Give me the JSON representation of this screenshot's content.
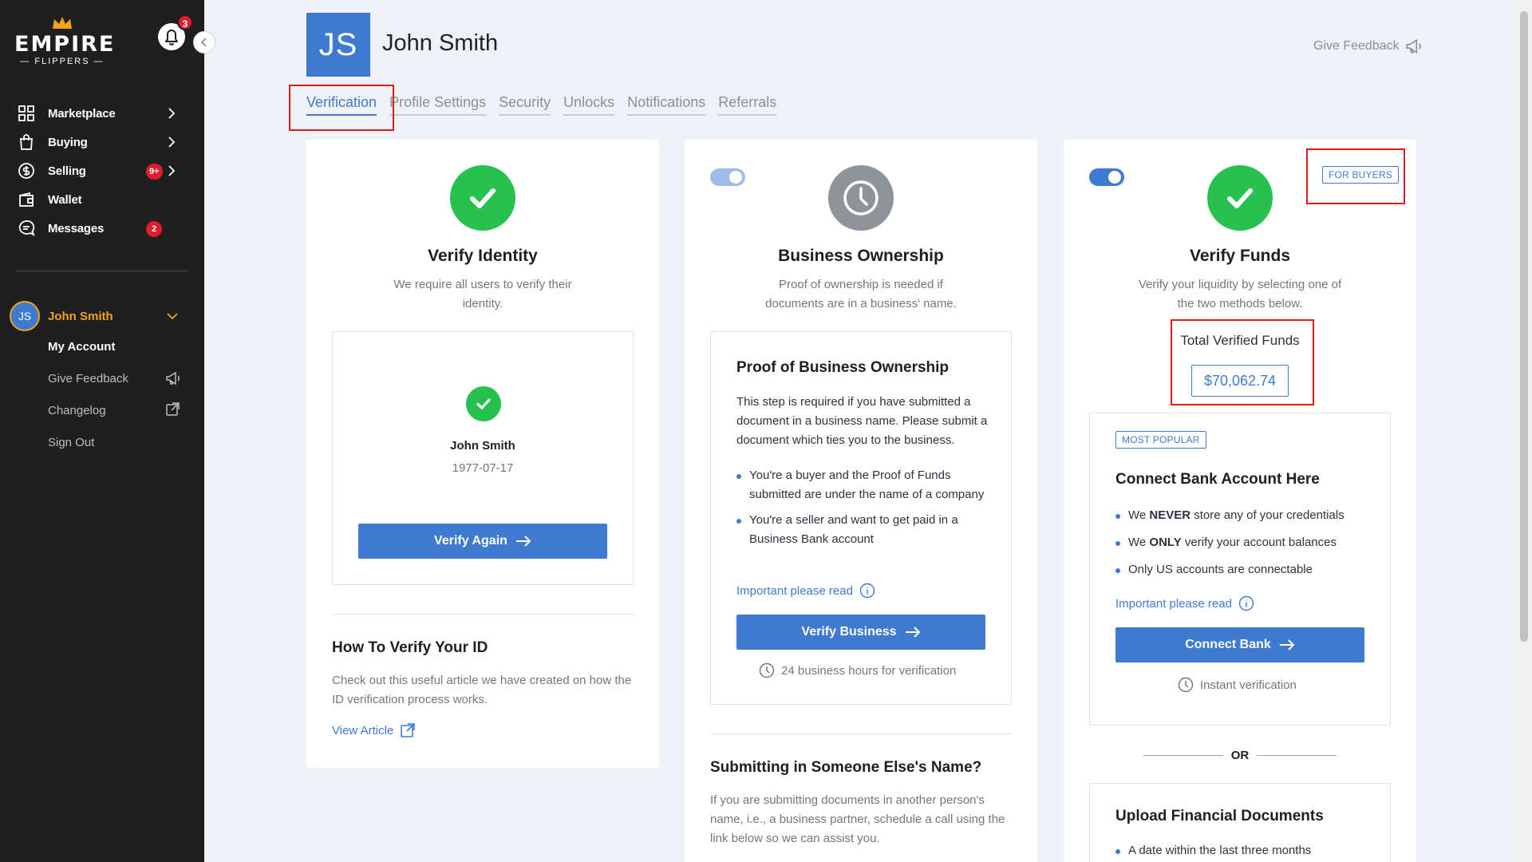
{
  "sidebar": {
    "logo": {
      "word": "EMPIRE",
      "sub": "— FLIPPERS —"
    },
    "notifications_count": "3",
    "nav": [
      {
        "label": "Marketplace",
        "icon": "grid-icon",
        "has_chevron": true
      },
      {
        "label": "Buying",
        "icon": "shopping-bag-icon",
        "has_chevron": true
      },
      {
        "label": "Selling",
        "icon": "dollar-circle-icon",
        "badge": "9+",
        "has_chevron": true
      },
      {
        "label": "Wallet",
        "icon": "wallet-icon"
      },
      {
        "label": "Messages",
        "icon": "chat-icon",
        "badge": "2"
      }
    ],
    "user": {
      "initials": "JS",
      "name": "John Smith",
      "menu": [
        {
          "label": "My Account",
          "active": true
        },
        {
          "label": "Give Feedback",
          "icon": "megaphone-icon"
        },
        {
          "label": "Changelog",
          "icon": "external-link-icon"
        },
        {
          "label": "Sign Out"
        }
      ]
    }
  },
  "header": {
    "initials": "JS",
    "name": "John Smith",
    "feedback_label": "Give Feedback"
  },
  "tabs": [
    {
      "label": "Verification",
      "active": true
    },
    {
      "label": "Profile Settings"
    },
    {
      "label": "Security"
    },
    {
      "label": "Unlocks"
    },
    {
      "label": "Notifications"
    },
    {
      "label": "Referrals"
    }
  ],
  "identity": {
    "title": "Verify Identity",
    "desc": "We require all users to verify their identity.",
    "verified_name": "John Smith",
    "dob": "1977-07-17",
    "button": "Verify Again",
    "howto_title": "How To Verify Your ID",
    "howto_desc": "Check out this useful article we have created on how the ID verification process works.",
    "link": "View Article"
  },
  "business": {
    "title": "Business Ownership",
    "desc": "Proof of ownership is needed if documents are in a business' name.",
    "proof_title": "Proof of Business Ownership",
    "proof_desc": "This step is required if you have submitted a document in a business name. Please submit a document which ties you to the business.",
    "bullets": [
      "You're a buyer and the Proof of Funds submitted are under the name of a company",
      "You're a seller and want to get paid in a Business Bank account"
    ],
    "important": "Important please read",
    "button": "Verify Business",
    "hours": "24 business hours for verification",
    "other_title": "Submitting in Someone Else's Name?",
    "other_desc": "If you are submitting documents in another person's name, i.e., a business partner, schedule a call using the link below so we can assist you."
  },
  "funds": {
    "tag": "FOR BUYERS",
    "title": "Verify Funds",
    "desc": "Verify your liquidity by selecting one of the two methods below.",
    "total_label": "Total Verified Funds",
    "total_value": "$70,062.74",
    "popular_tag": "MOST POPULAR",
    "bank_title": "Connect Bank Account Here",
    "bank_bullets": [
      {
        "pre": "We ",
        "strong": "NEVER",
        "post": " store any of your credentials"
      },
      {
        "pre": "We ",
        "strong": "ONLY",
        "post": " verify your account balances"
      },
      {
        "pre": "Only US accounts are connectable",
        "strong": "",
        "post": ""
      }
    ],
    "important": "Important please read",
    "button": "Connect Bank",
    "instant": "Instant verification",
    "or": "OR",
    "upload_title": "Upload Financial Documents",
    "upload_bullets": [
      "A date within the last three months"
    ]
  },
  "colors": {
    "accent": "#3f7ad1",
    "success": "#27c14f",
    "alert": "#e21d2b",
    "brand_gold": "#f2a31c",
    "sidebar_bg": "#1f1f1f"
  }
}
